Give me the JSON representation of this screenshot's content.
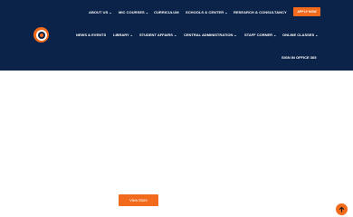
{
  "top_nav": [
    {
      "label": "ABOUT US",
      "dropdown": true
    },
    {
      "label": "MIC COURSES",
      "dropdown": true
    },
    {
      "label": "CURRICULUM",
      "dropdown": false
    },
    {
      "label": "SCHOOLS & CENTER",
      "dropdown": true
    },
    {
      "label": "RESEARCH & CONSULTANCY",
      "dropdown": false
    }
  ],
  "apply_button": "APPLY NOW",
  "main_nav": [
    {
      "label": "NEWS & EVENTS",
      "dropdown": false
    },
    {
      "label": "LIBRARY",
      "dropdown": true
    },
    {
      "label": "STUDENT AFFAIRS",
      "dropdown": true
    },
    {
      "label": "CENTRAL ADMINISTRATION",
      "dropdown": true
    },
    {
      "label": "STAFF CORNER",
      "dropdown": true
    },
    {
      "label": "ONLINE CLASSES",
      "dropdown": true
    }
  ],
  "signin_label": "SIGN IN OFFICE 365",
  "view_more_label": "View More",
  "colors": {
    "header_bg": "#0b2348",
    "accent": "#f26a1b",
    "text_on_dark": "#ffffff"
  },
  "icons": {
    "logo": "college-logo-icon",
    "scroll_top": "arrow-up-icon",
    "dropdown": "chevron-down-icon"
  }
}
